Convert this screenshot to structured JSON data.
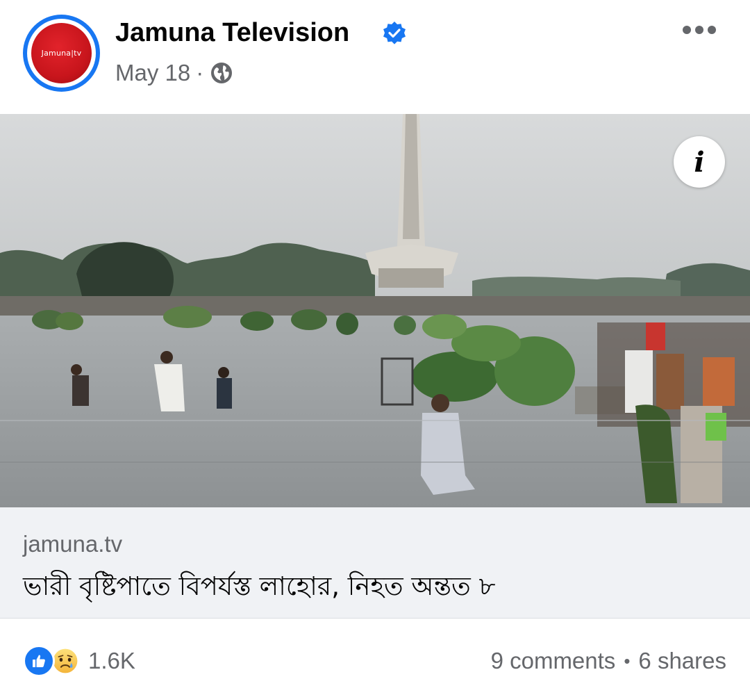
{
  "post": {
    "page_name": "Jamuna Television",
    "avatar_text": "Jamuna|tv",
    "date": "May 18",
    "separator": "·",
    "audience_icon": "globe-icon",
    "verified_icon": "verified-badge-icon",
    "more_icon": "more-options-icon"
  },
  "photo": {
    "info_label": "i"
  },
  "link": {
    "domain": "jamuna.tv",
    "title": "ভারী বৃষ্টিপাতে বিপর্যস্ত লাহোর, নিহত অন্তত ৮"
  },
  "engagement": {
    "reactions": [
      "like-icon",
      "sad-icon"
    ],
    "reaction_count": "1.6K",
    "comments": "9 comments",
    "dot": "•",
    "shares": "6 shares"
  },
  "colors": {
    "accent": "#1877f2",
    "secondary_text": "#65676b",
    "link_bg": "#f0f2f5",
    "brand_red": "#c8151c"
  }
}
